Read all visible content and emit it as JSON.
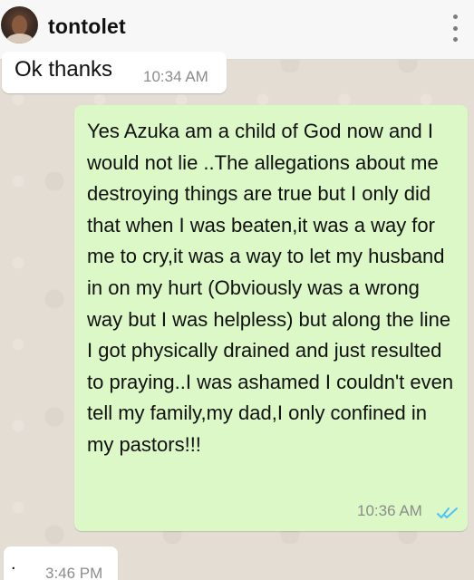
{
  "header": {
    "contact_name": "tontolet",
    "avatar_icon": "avatar",
    "menu_icon": "more-vertical-icon"
  },
  "messages": [
    {
      "direction": "incoming",
      "text": "Ok thanks",
      "time": "10:34 AM"
    },
    {
      "direction": "outgoing",
      "text": "Yes Azuka am a child of God now and I would not lie ..The allegations about me destroying things are true but I only did that when I was beaten,it was a way for me to cry,it was a way to let my husband in on my hurt (Obviously was a wrong way but I was helpless) but along the line I got physically drained and just resulted to praying..I was ashamed I couldn't even tell my family,my dad,I only confined in my pastors!!!",
      "time": "10:36 AM",
      "status": "read",
      "status_color": "#4fc3f7"
    },
    {
      "direction": "incoming",
      "text": ".",
      "time": "3:46 PM"
    }
  ],
  "colors": {
    "incoming_bubble": "#ffffff",
    "outgoing_bubble": "#dcf8c6",
    "chat_background": "#e4ddd4",
    "header_background": "#f7f7f7"
  }
}
